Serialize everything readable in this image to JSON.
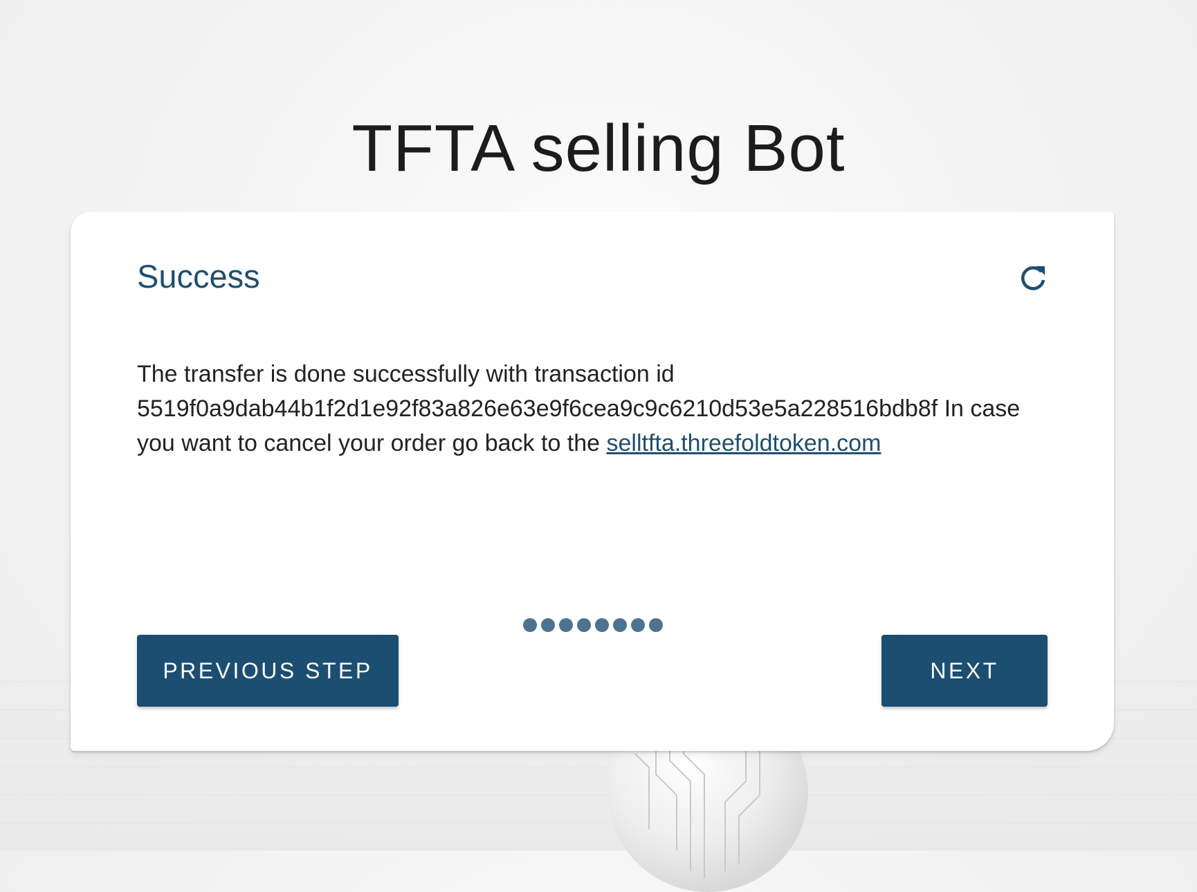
{
  "page": {
    "title": "TFTA selling Bot"
  },
  "card": {
    "title": "Success",
    "refresh_icon": "refresh-icon",
    "message_text": "The transfer is done successfully with transaction id 5519f0a9dab44b1f2d1e92f83a826e63e9f6cea9c9c6210d53e5a228516bdb8f In case you want to cancel your order go back to the ",
    "link_text": "selltfta.threefoldtoken.com"
  },
  "stepper": {
    "total_steps": 8
  },
  "buttons": {
    "previous_label": "PREVIOUS STEP",
    "next_label": "NEXT"
  },
  "colors": {
    "primary": "#1c4e72",
    "title_blue": "#1f4e70",
    "dot": "#4d7391"
  }
}
